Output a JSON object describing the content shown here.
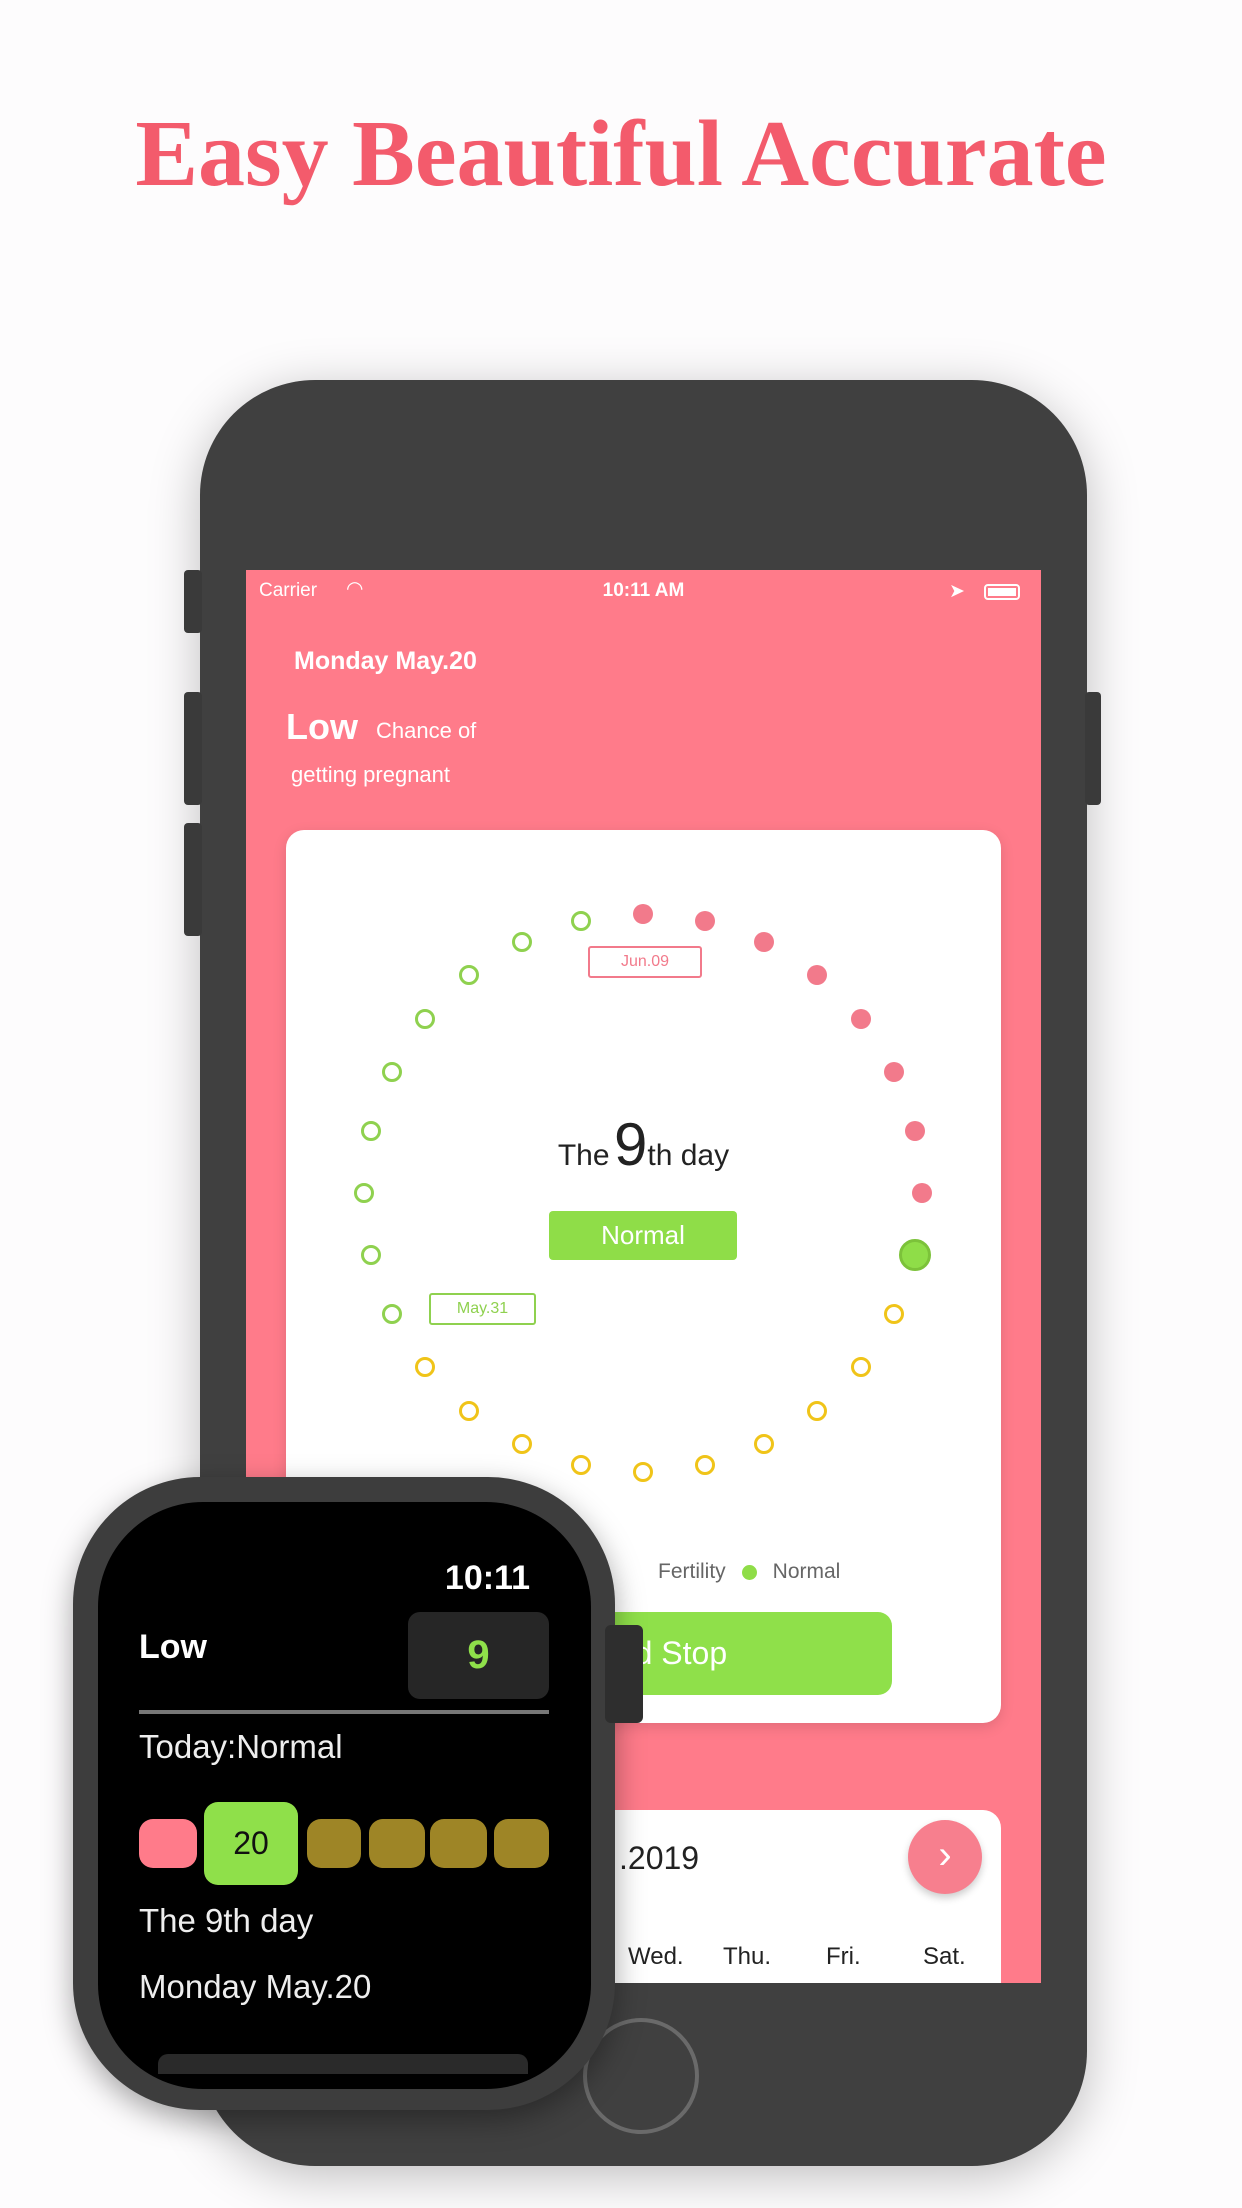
{
  "headline": "Easy Beautiful Accurate",
  "phone": {
    "status_bar": {
      "carrier": "Carrier",
      "time": "10:11 AM"
    },
    "date": "Monday May.20",
    "chance_level": "Low",
    "chance_text_1": "Chance of",
    "chance_text_2": "getting pregnant",
    "cycle": {
      "day_prefix": "The",
      "day_number": "9",
      "day_suffix": "th day",
      "status_badge": "Normal",
      "dots": [
        "period",
        "period",
        "period",
        "period",
        "period",
        "period",
        "period",
        "period",
        "today",
        "fertility",
        "fertility",
        "fertility",
        "fertility",
        "fertility",
        "fertility",
        "fertility",
        "fertility",
        "fertility",
        "fertility",
        "normal",
        "normal",
        "normal",
        "normal",
        "normal",
        "normal",
        "normal",
        "normal",
        "normal"
      ],
      "label_top": "Jun.09",
      "label_left": "May.31"
    },
    "legend": [
      {
        "label": "Fertility",
        "color": "#f0c419"
      },
      {
        "label": "Normal",
        "color": "#8fdd48"
      }
    ],
    "action_button": "Period Stop",
    "calendar": {
      "month": ".2019",
      "weekdays": [
        "Wed.",
        "Thu.",
        "Fri.",
        "Sat."
      ]
    }
  },
  "watch": {
    "time": "10:11",
    "level": "Low",
    "day_number": "9",
    "today_status": "Today:Normal",
    "date_pill": "20",
    "day_text": "The 9th day",
    "date": "Monday May.20"
  },
  "colors": {
    "pink": "#ff7b8a",
    "period": "#f27a8b",
    "today": "#8fdd48",
    "fertility": "#f0c419",
    "normal": "#8fd14f",
    "olive": "#9e8526"
  }
}
